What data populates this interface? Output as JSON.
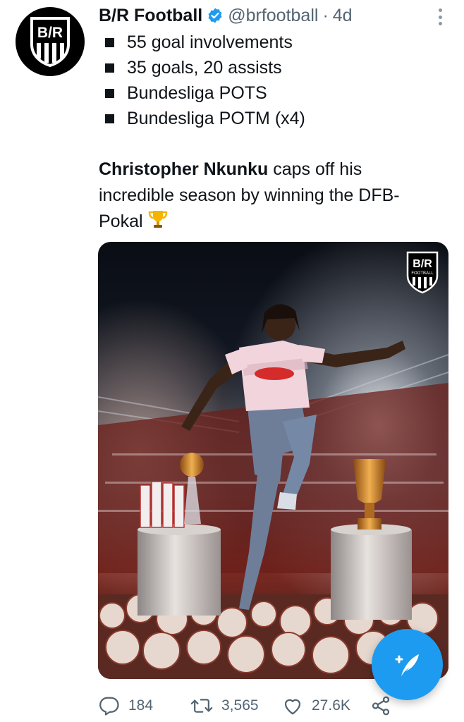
{
  "tweet": {
    "account_name": "B/R Football",
    "handle": "@brfootball",
    "separator": "·",
    "time": "4d",
    "avatar_text": "B/R",
    "bullets": [
      "55 goal involvements",
      "35 goals, 20 assists",
      "Bundesliga POTS",
      "Bundesliga POTM (x4)"
    ],
    "body_bold": "Christopher Nkunku",
    "body_rest": " caps off his incredible season by winning the DFB-Pokal",
    "image_badge": {
      "top": "B/R",
      "bottom": "FOOTBALL"
    }
  },
  "actions": {
    "replies": "184",
    "retweets": "3,565",
    "likes": "27.6K"
  },
  "colors": {
    "accent": "#1d9bf0",
    "text": "#0f1419",
    "secondary": "#536471"
  },
  "icons": [
    "verified-badge-icon",
    "more-icon",
    "reply-icon",
    "retweet-icon",
    "like-icon",
    "share-icon",
    "compose-icon",
    "trophy-icon"
  ]
}
